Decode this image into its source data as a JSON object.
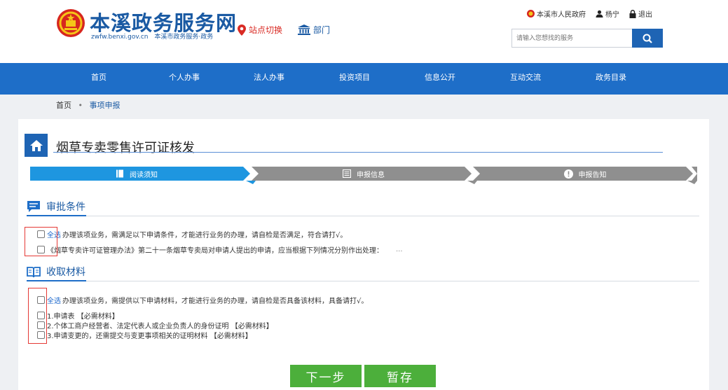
{
  "header": {
    "site_name": "本溪政务服务网",
    "domain": "zwfw.benxi.gov.cn",
    "sub_name": "本溪市政务服务·政务",
    "switch_label": "站点切换",
    "dept_label": "部门",
    "gov_link": "本溪市人民政府",
    "user_name": "杨宁",
    "logout_label": "退出",
    "search_placeholder": "请输入您想找的服务"
  },
  "nav": {
    "items": [
      "首页",
      "个人办事",
      "法人办事",
      "投资项目",
      "信息公开",
      "互动交流",
      "政务目录"
    ]
  },
  "breadcrumb": {
    "home": "首页",
    "separator": "•",
    "current": "事项申报"
  },
  "page": {
    "title": "烟草专卖零售许可证核发"
  },
  "steps": [
    {
      "label": "阅读须知",
      "icon": "book-icon",
      "active": true
    },
    {
      "label": "申报信息",
      "icon": "form-icon",
      "active": false
    },
    {
      "label": "申报告知",
      "icon": "alert-icon",
      "active": false
    }
  ],
  "conditions": {
    "heading": "审批条件",
    "select_all": "全选",
    "intro": "办理该项业务，需满足以下申请条件，才能进行业务的办理，请自检是否满足，符合请打√。",
    "items": [
      "《烟草专卖许可证管理办法》第二十一条烟草专卖局对申请人提出的申请，应当根据下列情况分别作出处理：",
      "..."
    ]
  },
  "materials": {
    "heading": "收取材料",
    "select_all": "全选",
    "intro": "办理该项业务，需提供以下申请材料，才能进行业务的办理，请自检是否具备该材料，具备请打√。",
    "items": [
      "1.申请表 【必需材料】",
      "2.个体工商户经营者、法定代表人或企业负责人的身份证明 【必需材料】",
      "3.申请变更的，还需提交与变更事项相关的证明材料 【必需材料】"
    ]
  },
  "buttons": {
    "next": "下一步",
    "save": "暂存"
  },
  "colors": {
    "brand_blue": "#1e6ec8",
    "active_step": "#1e96e0",
    "inactive_step": "#8f8f8f",
    "button_green": "#4caf3b",
    "highlight_red": "#e53935"
  }
}
